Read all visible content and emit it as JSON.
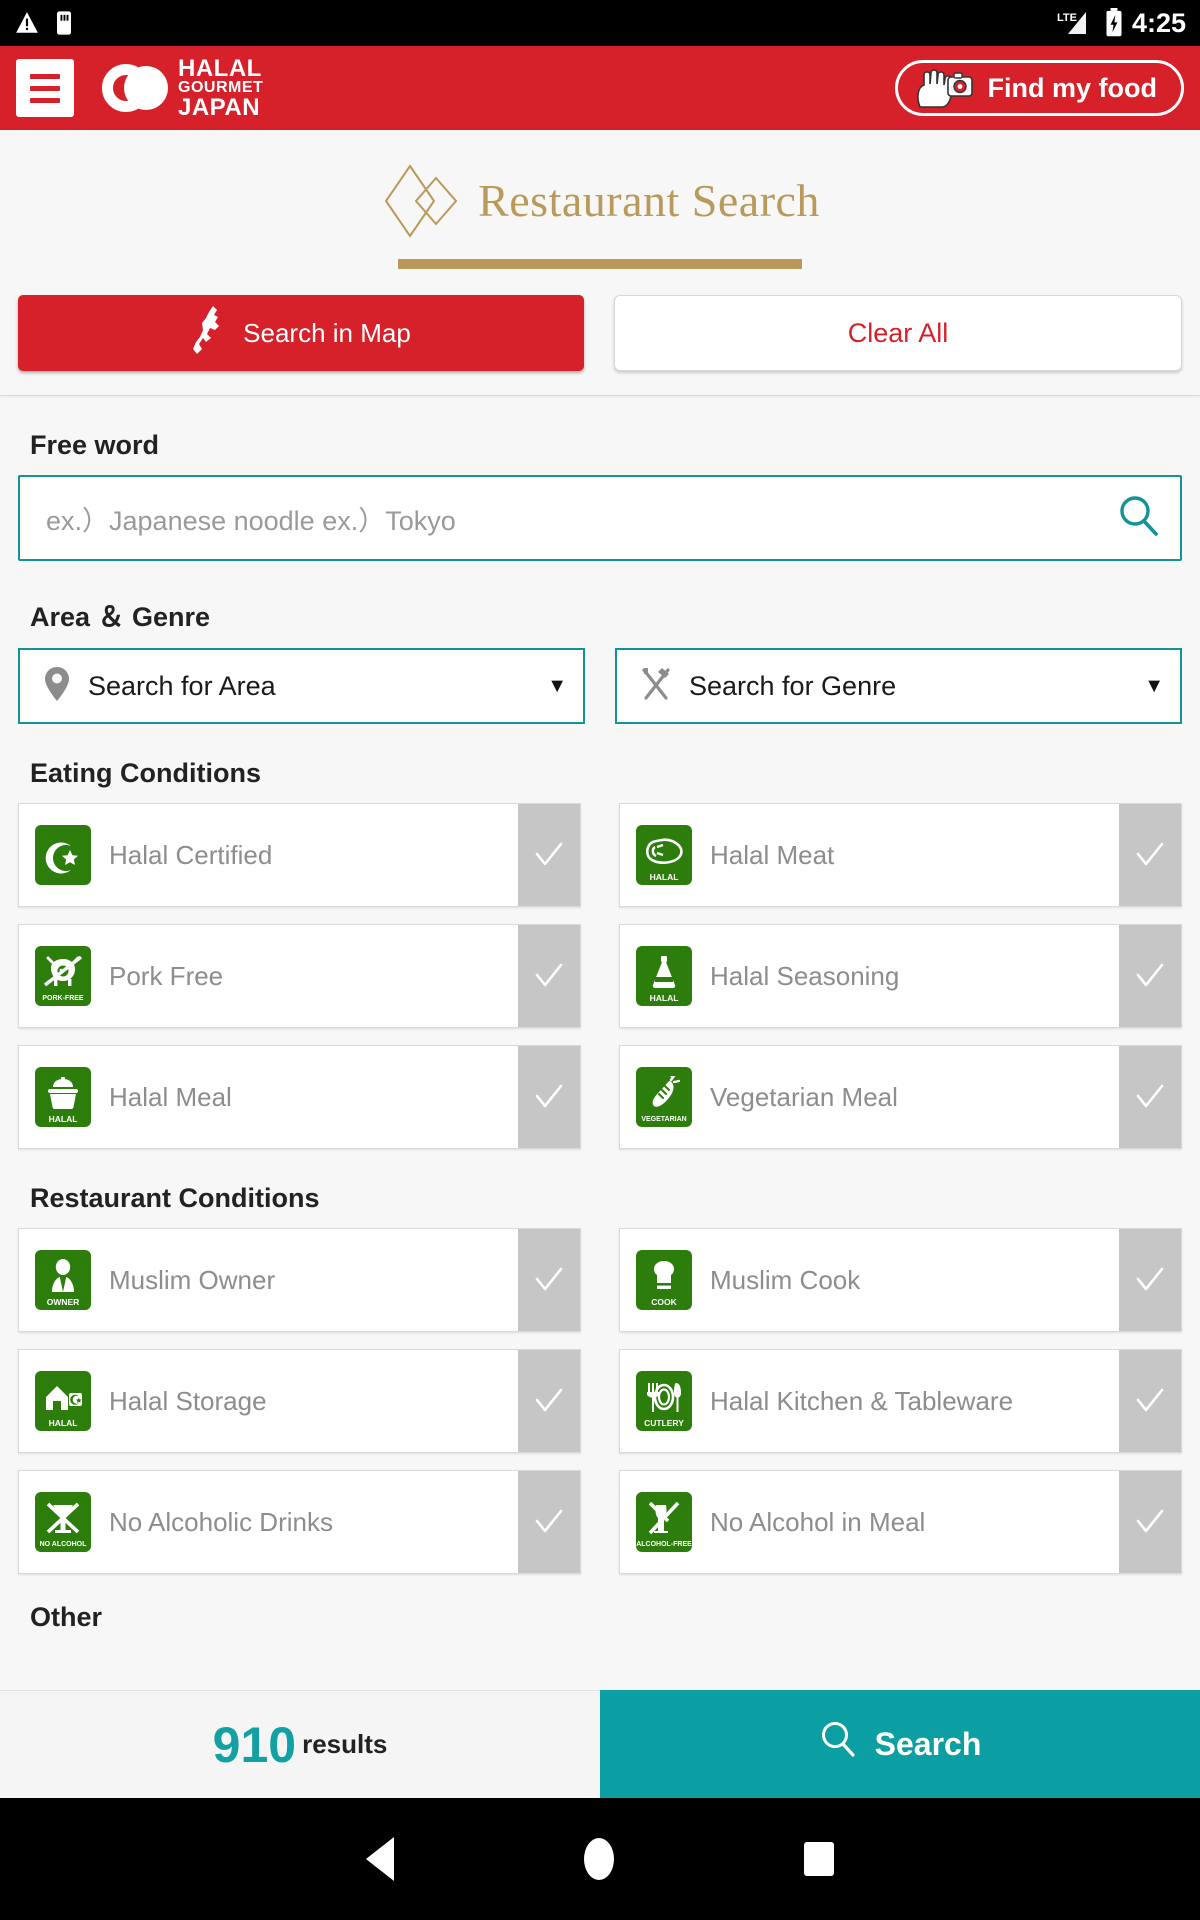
{
  "statusbar": {
    "time": "4:25",
    "network_label": "LTE",
    "icons": [
      "warning-icon",
      "usb-storage-icon",
      "signal-icon",
      "battery-charging-icon"
    ]
  },
  "appbar": {
    "menu_icon": "hamburger-menu-icon",
    "brand": {
      "line1": "HALAL",
      "line2": "GOURMET",
      "line3": "JAPAN"
    },
    "find_my_food_label": "Find my food",
    "background_color": "#d6202a"
  },
  "page": {
    "title": "Restaurant Search",
    "title_color": "#b99a5b"
  },
  "top_buttons": {
    "search_in_map": "Search in Map",
    "clear_all": "Clear All",
    "map_button_color": "#d6202a",
    "clear_text_color": "#d6202a"
  },
  "free_word": {
    "label": "Free word",
    "placeholder": "ex.）Japanese noodle ex.）Tokyo",
    "value": "",
    "border_color": "#139396"
  },
  "area_genre": {
    "label": "Area ＆ Genre",
    "area": {
      "value": "Search for Area",
      "icon": "map-pin-icon",
      "caret": "▼"
    },
    "genre": {
      "value": "Search for Genre",
      "icon": "fork-knife-icon",
      "caret": "▼"
    }
  },
  "eating_conditions": {
    "label": "Eating Conditions",
    "items": [
      {
        "label": "Halal Certified",
        "icon": "halal-certified-icon",
        "caption": "",
        "checked": false
      },
      {
        "label": "Halal Meat",
        "icon": "halal-meat-icon",
        "caption": "HALAL",
        "checked": false
      },
      {
        "label": "Pork Free",
        "icon": "pork-free-icon",
        "caption": "PORK-FREE",
        "checked": false
      },
      {
        "label": "Halal Seasoning",
        "icon": "halal-seasoning-icon",
        "caption": "HALAL",
        "checked": false
      },
      {
        "label": "Halal Meal",
        "icon": "halal-meal-icon",
        "caption": "HALAL",
        "checked": false
      },
      {
        "label": "Vegetarian Meal",
        "icon": "vegetarian-meal-icon",
        "caption": "VEGETARIAN",
        "checked": false
      }
    ]
  },
  "restaurant_conditions": {
    "label": "Restaurant Conditions",
    "items": [
      {
        "label": "Muslim Owner",
        "icon": "muslim-owner-icon",
        "caption": "OWNER",
        "checked": false
      },
      {
        "label": "Muslim Cook",
        "icon": "muslim-cook-icon",
        "caption": "COOK",
        "checked": false
      },
      {
        "label": "Halal Storage",
        "icon": "halal-storage-icon",
        "caption": "HALAL",
        "checked": false
      },
      {
        "label": "Halal Kitchen & Tableware",
        "icon": "halal-cutlery-icon",
        "caption": "CUTLERY",
        "checked": false
      },
      {
        "label": "No Alcoholic Drinks",
        "icon": "no-alcohol-icon",
        "caption": "NO ALCOHOL",
        "checked": false
      },
      {
        "label": "No Alcohol in Meal",
        "icon": "alcohol-free-icon",
        "caption": "ALCOHOL-FREE",
        "checked": false
      }
    ]
  },
  "other": {
    "label": "Other"
  },
  "footer": {
    "results_count": "910",
    "results_word": "results",
    "search_label": "Search",
    "search_icon": "search-icon",
    "accent_color": "#0b9ea2",
    "count_color": "#12a0a3"
  },
  "navbar": {
    "back": "back-triangle-icon",
    "home": "home-circle-icon",
    "recent": "recent-square-icon"
  }
}
